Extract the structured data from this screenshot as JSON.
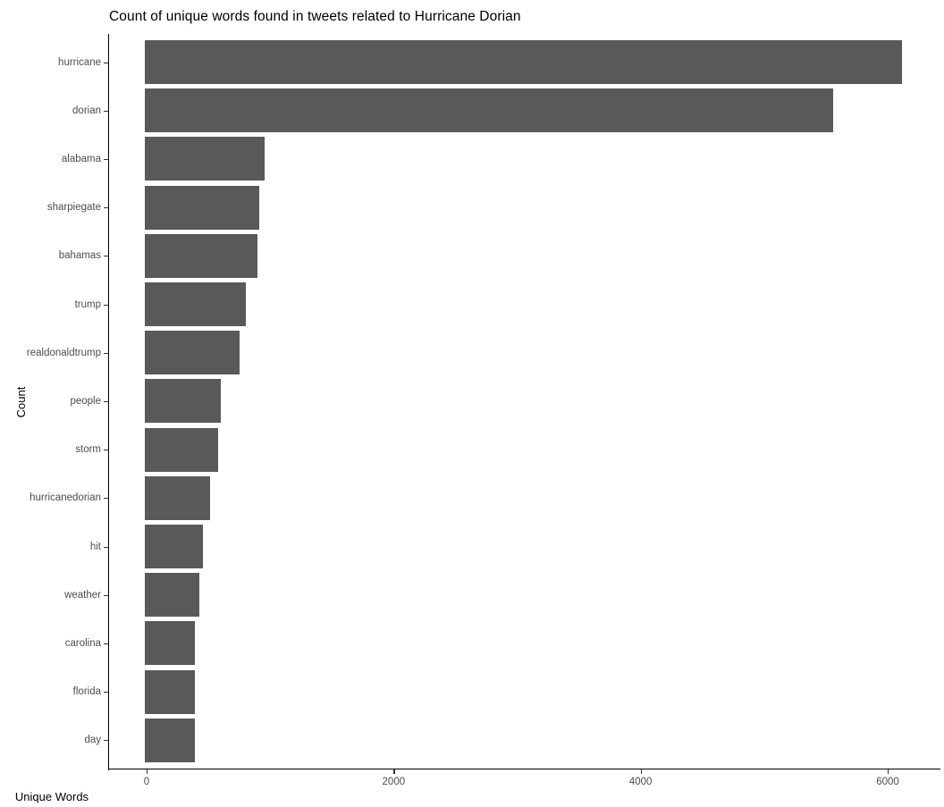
{
  "chart_data": {
    "type": "bar",
    "orientation": "horizontal",
    "title": "Count of unique words found in tweets related to Hurricane Dorian",
    "xlabel": "Unique Words",
    "ylabel": "Count",
    "categories": [
      "hurricane",
      "dorian",
      "alabama",
      "sharpiegate",
      "bahamas",
      "trump",
      "realdonaldtrump",
      "people",
      "storm",
      "hurricanedorian",
      "hit",
      "weather",
      "carolina",
      "florida",
      "day"
    ],
    "values": [
      6114,
      5557,
      955,
      912,
      897,
      803,
      753,
      600,
      579,
      514,
      456,
      427,
      391,
      391,
      391
    ],
    "xlim": [
      0,
      6300
    ],
    "xticks": [
      0,
      2000,
      4000,
      6000
    ],
    "xtick_labels": [
      "0",
      "2000",
      "4000",
      "6000"
    ],
    "grid": false,
    "legend": false,
    "bar_color": "#595959",
    "background_color": "#ffffff",
    "axis_text_color": "#4d4d4d",
    "axis_line_color": "#000000"
  }
}
